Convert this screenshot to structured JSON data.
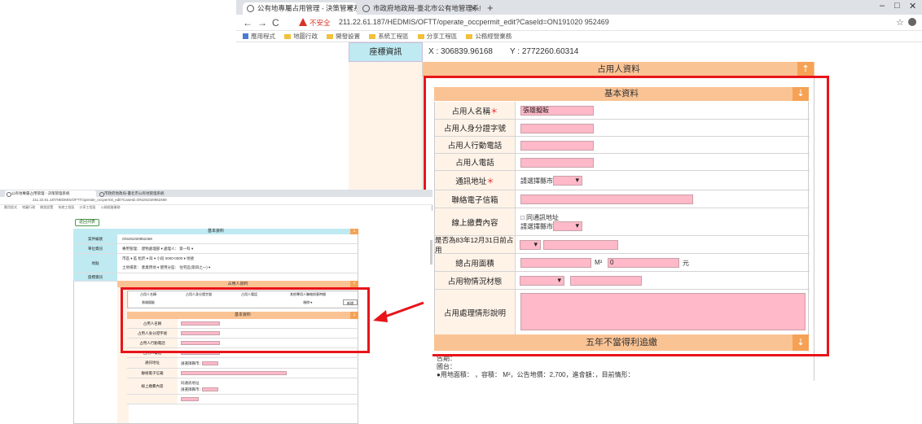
{
  "main_browser": {
    "tabs": [
      {
        "title": "公有地專屬占用管理 - 決策管理系統"
      },
      {
        "title": "市政府地政局-臺北市公有地管理系統"
      }
    ],
    "new_tab": "+",
    "window_controls": {
      "minimize": "–",
      "maximize": "□",
      "close": "✕"
    },
    "nav": {
      "back": "←",
      "forward": "→",
      "reload": "C"
    },
    "security_label": "不安全",
    "url": "211.22.61.187/HEDMIS/OFTT/operate_occpermit_edit?CaseId=ON191020 952469",
    "bookmarks": [
      "應用程式",
      "地圖行政",
      "開發設置",
      "系統工程區",
      "分享工程區",
      "公務經營業務"
    ]
  },
  "coords": {
    "label": "座標資訊",
    "x": "X : 306839.96168",
    "y": "Y : 2772260.60314"
  },
  "occupant_section": {
    "title": "占用人資料",
    "arrow": "⇡"
  },
  "basic_section": {
    "title": "基本資料",
    "arrow": "⇣"
  },
  "form": {
    "name_label": "占用人名稱",
    "name_value": "張雄擬販",
    "id_label": "占用人身分證字號",
    "mobile_label": "占用人行動電話",
    "phone_label": "占用人電話",
    "address_label": "通訊地址",
    "address_select": "請選擇縣市：",
    "email_label": "聯絡電子信箱",
    "mail_label": "線上繳費內容",
    "mail_checkbox_text": "□ 同通訊地址",
    "mail_select": "請選擇縣市：",
    "date_label": "是否為83年12月31日前占用",
    "area_label": "總占用面積",
    "area_unit": "M²",
    "area_value": "0",
    "money_unit": "元",
    "material_label": "占用物情況材態",
    "desc_label": "占用處理情形說明"
  },
  "five_year_section": {
    "title": "五年不當得利追繳",
    "arrow": "⇣"
  },
  "below_text": {
    "line1": "告期：",
    "line2": "國台：",
    "line3": "●用地面積：        ，容積：         M²，公告地價：2,700，進會額：，目前情形："
  },
  "small_browser": {
    "tabs": [
      "公有地專屬占用管理 - 決策管理系統",
      "市政府地政局-臺北市公有地管理系統"
    ],
    "url": "211.22.61.187/HEDMIS/OFTT/operate_occpermit_edit?CaseId=ON191020952469",
    "bookmarks": [
      "應用程式",
      "地圖行政",
      "開發設置",
      "系統工程區",
      "分享工程區",
      "公務經營業務"
    ],
    "back_button": "返回列表",
    "header": "基本資料",
    "case_label": "案件編號",
    "case_value": "ON191020952469",
    "unit_label": "單位資訊",
    "unit_text": "專用管理： 建物處理部 ▾   處理人： 第一科 ▾",
    "loc_label": "地點",
    "loc_text1": "市區 ▾ 區 松菸 ▾ 段   ▾ 小段 0000-0000 ▾ 地號",
    "loc_text2": "土地場景：  產業用地 ▾   使用分區：  住宅區(第四之一) ▾",
    "coord_label": "座標資訊",
    "occ_header": "占用人資料",
    "occ_cols": [
      "占用人名稱",
      "占用人身分證字號",
      "占用人電話",
      "其他專用人聯絡與意時間"
    ],
    "occ_row": [
      "張雄擬販",
      "",
      "",
      "刪除➜"
    ],
    "occ_button": "新增",
    "basic_header": "基本資料",
    "basic_rows": [
      "占用人名稱",
      "占用人身分證字號",
      "占用人行動電話",
      "占用人電話",
      "通訊地址",
      "聯絡電子信箱",
      "線上繳費內容"
    ],
    "basic_select": "請選擇縣市：",
    "mail_checkbox": "同通訊地址"
  },
  "arrow_symbols": {
    "up": "⇡",
    "down": "⇣"
  }
}
